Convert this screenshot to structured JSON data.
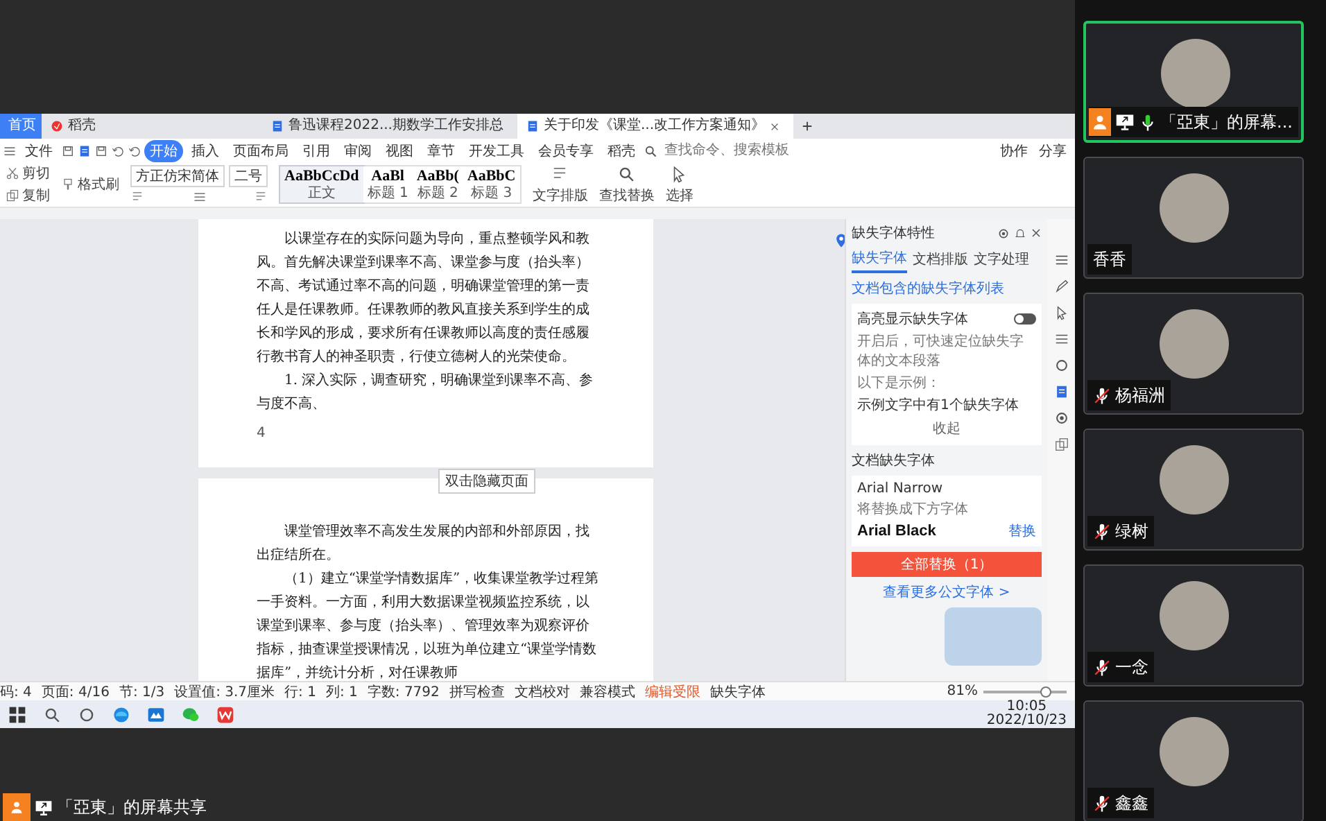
{
  "shared_screen": {
    "wps": {
      "tabs": [
        {
          "label": "首页",
          "kind": "home",
          "selected": false
        },
        {
          "label": "稻壳",
          "kind": "brand",
          "selected": false
        },
        {
          "label": "鲁迅课程2022...期数学工作安排总",
          "kind": "doc",
          "selected": false
        },
        {
          "label": "关于印发《课堂...改工作方案通知》",
          "kind": "doc",
          "selected": true
        }
      ],
      "file_menu": "文件",
      "menu": [
        {
          "label": "开始",
          "selected": true
        },
        {
          "label": "插入",
          "selected": false
        },
        {
          "label": "页面布局",
          "selected": false
        },
        {
          "label": "引用",
          "selected": false
        },
        {
          "label": "审阅",
          "selected": false
        },
        {
          "label": "视图",
          "selected": false
        },
        {
          "label": "章节",
          "selected": false
        },
        {
          "label": "开发工具",
          "selected": false
        },
        {
          "label": "会员专享",
          "selected": false
        },
        {
          "label": "稻壳",
          "selected": false
        }
      ],
      "search": {
        "placeholder": "查找命令、搜索模板"
      },
      "top_actions": [
        "协作",
        "分享"
      ],
      "clipboard": [
        "剪切",
        "复制",
        "格式刷"
      ],
      "font": {
        "name": "方正仿宋简体",
        "size": "二号"
      },
      "styles": [
        {
          "preview": "AaBbCcDd",
          "label": "正文",
          "selected": true
        },
        {
          "preview": "AaBl",
          "label": "标题 1",
          "selected": false
        },
        {
          "preview": "AaBb(",
          "label": "标题 2",
          "selected": false
        },
        {
          "preview": "AaBbC",
          "label": "标题 3",
          "selected": false
        }
      ],
      "tools": [
        "文字排版",
        "查找替换",
        "选择"
      ],
      "pages": [
        {
          "paragraphs": [
            "以课堂存在的实际问题为导向，重点整顿学风和教风。首先解决课堂到课率不高、课堂参与度（抬头率）不高、考试通过率不高的问题，明确课堂管理的第一责任人是任课教师。任课教师的教风直接关系到学生的成长和学风的形成，要求所有任课教师以高度的责任感履行教书育人的神圣职责，行使立德树人的光荣使命。",
            "1. 深入实际，调查研究，明确课堂到课率不高、参与度不高、"
          ],
          "page_number": "4"
        },
        {
          "paragraphs": [
            "课堂管理效率不高发生发展的内部和外部原因，找出症结所在。",
            "（1）建立“课堂学情数据库”，收集课堂教学过程第一手资料。一方面，利用大数据课堂视频监控系统，以课堂到课率、参与度（抬头率）、管理效率为观察评价指标，抽查课堂授课情况，以班为单位建立“课堂学情数据库”，并统计分析，对任课教师"
          ]
        }
      ],
      "tooltip": "双击隐藏页面",
      "side_panel": {
        "title": "缺失字体特性",
        "tabs": [
          {
            "label": "缺失字体",
            "selected": true
          },
          {
            "label": "文档排版",
            "selected": false
          },
          {
            "label": "文字处理",
            "selected": false
          }
        ],
        "link": "文档包含的缺失字体列表",
        "highlight": {
          "label": "高亮显示缺失字体",
          "on": false,
          "description": "开启后，可快速定位缺失字体的文本段落",
          "example_label": "以下是示例：",
          "example": "示例文字中有1个缺失字体",
          "collapse": "收起"
        },
        "section": "文档缺失字体",
        "missing": {
          "font": "Arial Narrow",
          "note": "将替换成下方字体",
          "replacement": "Arial Black",
          "action": "替换"
        },
        "replace_all": "全部替换（1）",
        "more_link": "查看更多公文字体 >"
      },
      "status_bar": [
        "码: 4",
        "页面: 4/16",
        "节: 1/3",
        "设置值: 3.7厘米",
        "行: 1",
        "列: 1",
        "字数: 7792"
      ],
      "status_tools": [
        "拼写检查",
        "文档校对",
        "兼容模式",
        "编辑受限",
        "缺失字体"
      ],
      "zoom": "81%",
      "zoom_slider": {
        "level": 0.75
      }
    },
    "taskbar": {
      "time": "10:05",
      "date": "2022/10/23"
    },
    "share_label": "「亞東」的屏幕共享"
  },
  "participants": [
    {
      "name": "「亞東」的屏幕...",
      "kind": "presenter",
      "muted": false,
      "selected": true
    },
    {
      "name": "香香",
      "kind": "participant",
      "muted": false,
      "selected": false
    },
    {
      "name": "杨福洲",
      "kind": "participant",
      "muted": true,
      "selected": false
    },
    {
      "name": "绿树",
      "kind": "participant",
      "muted": true,
      "selected": false
    },
    {
      "name": "一念",
      "kind": "participant",
      "muted": true,
      "selected": false
    },
    {
      "name": "鑫鑫",
      "kind": "participant",
      "muted": true,
      "selected": false
    }
  ]
}
